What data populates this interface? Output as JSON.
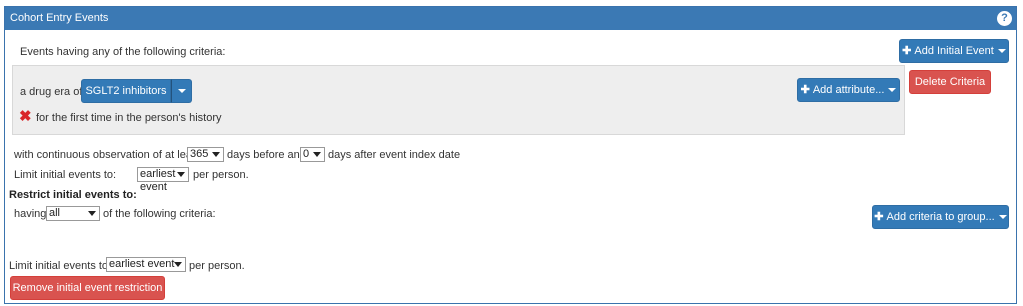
{
  "panel": {
    "title": "Cohort Entry Events",
    "help_icon": "?"
  },
  "events_intro": "Events having any of the following criteria:",
  "add_initial_event_label": "Add Initial Event",
  "delete_criteria_label": "Delete Criteria",
  "criteria": {
    "prefix": "a drug era of",
    "concept_set": "SGLT2 inhibitors",
    "add_attribute_label": "Add attribute...",
    "first_time_text": "for the first time in the person's history"
  },
  "observation": {
    "prefix": "with continuous observation of at least",
    "days_before_value": "365",
    "mid": "days before and",
    "days_after_value": "0",
    "suffix": "days after event index date"
  },
  "limit1": {
    "prefix": "Limit initial events to:",
    "value": "earliest event",
    "suffix": "per person."
  },
  "restrict": {
    "heading": "Restrict initial events to:",
    "having": "having",
    "value": "all",
    "suffix": "of the following criteria:",
    "add_criteria_label": "Add criteria to group..."
  },
  "limit2": {
    "prefix": "Limit initial events to:",
    "value": "earliest event",
    "suffix": "per person."
  },
  "remove_restriction_label": "Remove initial event restriction"
}
